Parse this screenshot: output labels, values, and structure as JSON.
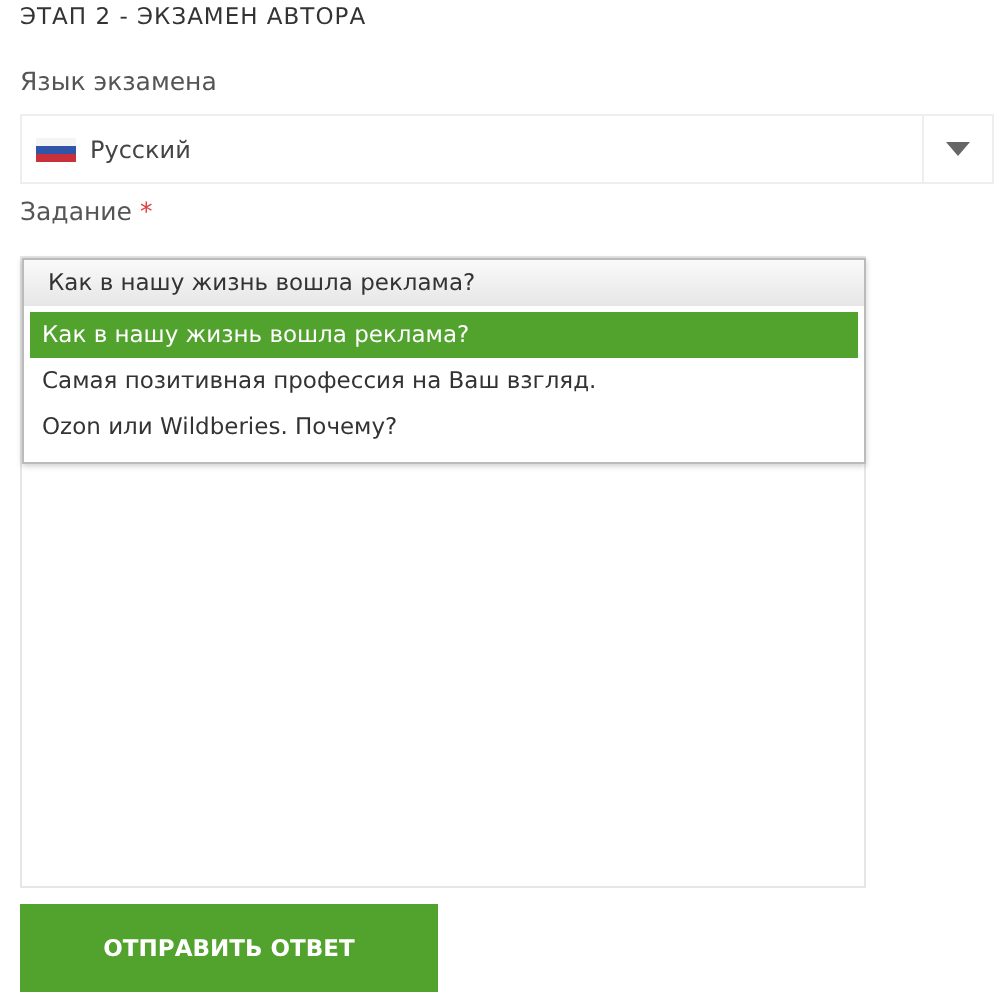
{
  "heading": "ЭТАП 2 - ЭКЗАМЕН АВТОРА",
  "language": {
    "label": "Язык экзамена",
    "value": "Русский"
  },
  "task": {
    "label": "Задание",
    "required_mark": "*",
    "value": "Как в нашу жизнь вошла реклама?",
    "options": [
      {
        "label": "Как в нашу жизнь вошла реклама?",
        "selected": true
      },
      {
        "label": "Самая позитивная профессия на Ваш взгляд.",
        "selected": false
      },
      {
        "label": "Ozon или Wildberies. Почему?",
        "selected": false
      }
    ]
  },
  "submit_button": "ОТПРАВИТЬ ОТВЕТ"
}
